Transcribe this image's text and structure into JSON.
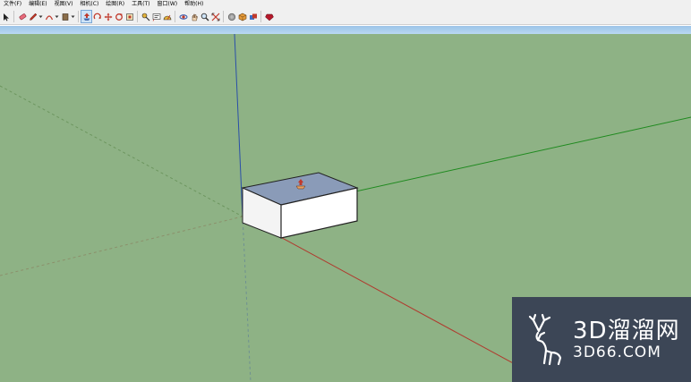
{
  "menubar": {
    "items": [
      "文件(F)",
      "编辑(E)",
      "视图(V)",
      "相机(C)",
      "绘图(R)",
      "工具(T)",
      "窗口(W)",
      "帮助(H)"
    ]
  },
  "toolbar": {
    "tools": [
      "select-icon",
      "eraser-icon",
      "pencil-icon",
      "arc-icon",
      "rectangle-icon",
      "push-pull-icon",
      "rotate-icon",
      "move-icon",
      "follow-me-icon",
      "offset-icon",
      "tape-measure-icon",
      "text-icon",
      "protractor-icon",
      "orbit-icon",
      "pan-icon",
      "zoom-icon",
      "zoom-extents-icon",
      "warehouse-icon",
      "extension-warehouse-icon",
      "component-icon",
      "ruby-icon"
    ],
    "active_tool": "push-pull-icon"
  },
  "viewport": {
    "background": "#8eb285",
    "axis_colors": {
      "red": "#b03a2e",
      "green": "#1f8a1f",
      "blue": "#2a4fa8"
    }
  },
  "watermark": {
    "cn": "3D溜溜网",
    "en": "3D66.COM"
  }
}
